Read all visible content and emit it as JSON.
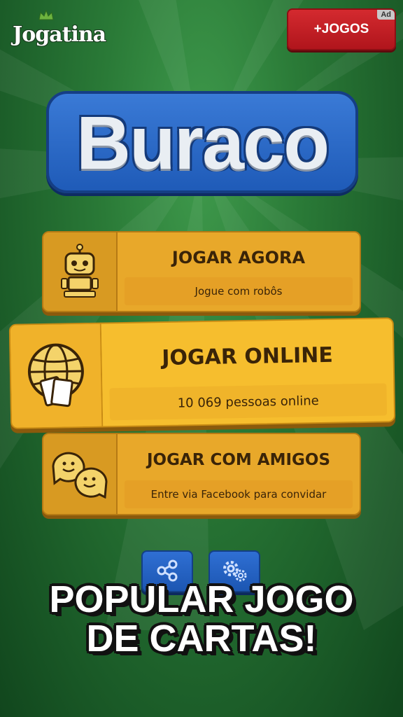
{
  "brand": {
    "logo_text": "Jogatina",
    "logo_icon": "crown-icon"
  },
  "header": {
    "more_games_label": "+JOGOS",
    "ad_badge": "Ad"
  },
  "title": "Buraco",
  "menu": {
    "play_now": {
      "label": "JOGAR AGORA",
      "sub": "Jogue com robôs",
      "icon": "robot-icon"
    },
    "play_online": {
      "label": "JOGAR ONLINE",
      "sub": "10 069 pessoas online",
      "icon": "globe-cards-icon"
    },
    "play_friends": {
      "label": "JOGAR COM AMIGOS",
      "sub": "Entre via Facebook para convidar",
      "icon": "chat-faces-icon"
    }
  },
  "footer_buttons": [
    {
      "icon": "share-icon"
    },
    {
      "icon": "settings-gears-icon"
    }
  ],
  "promo": {
    "line1": "POPULAR JOGO",
    "line2": "DE CARTAS!"
  },
  "colors": {
    "background": "#2a7a37",
    "button_gold": "#e8a82a",
    "button_highlight": "#f6be2e",
    "title_blue": "#1f5bb8",
    "ad_red": "#c41e24"
  }
}
